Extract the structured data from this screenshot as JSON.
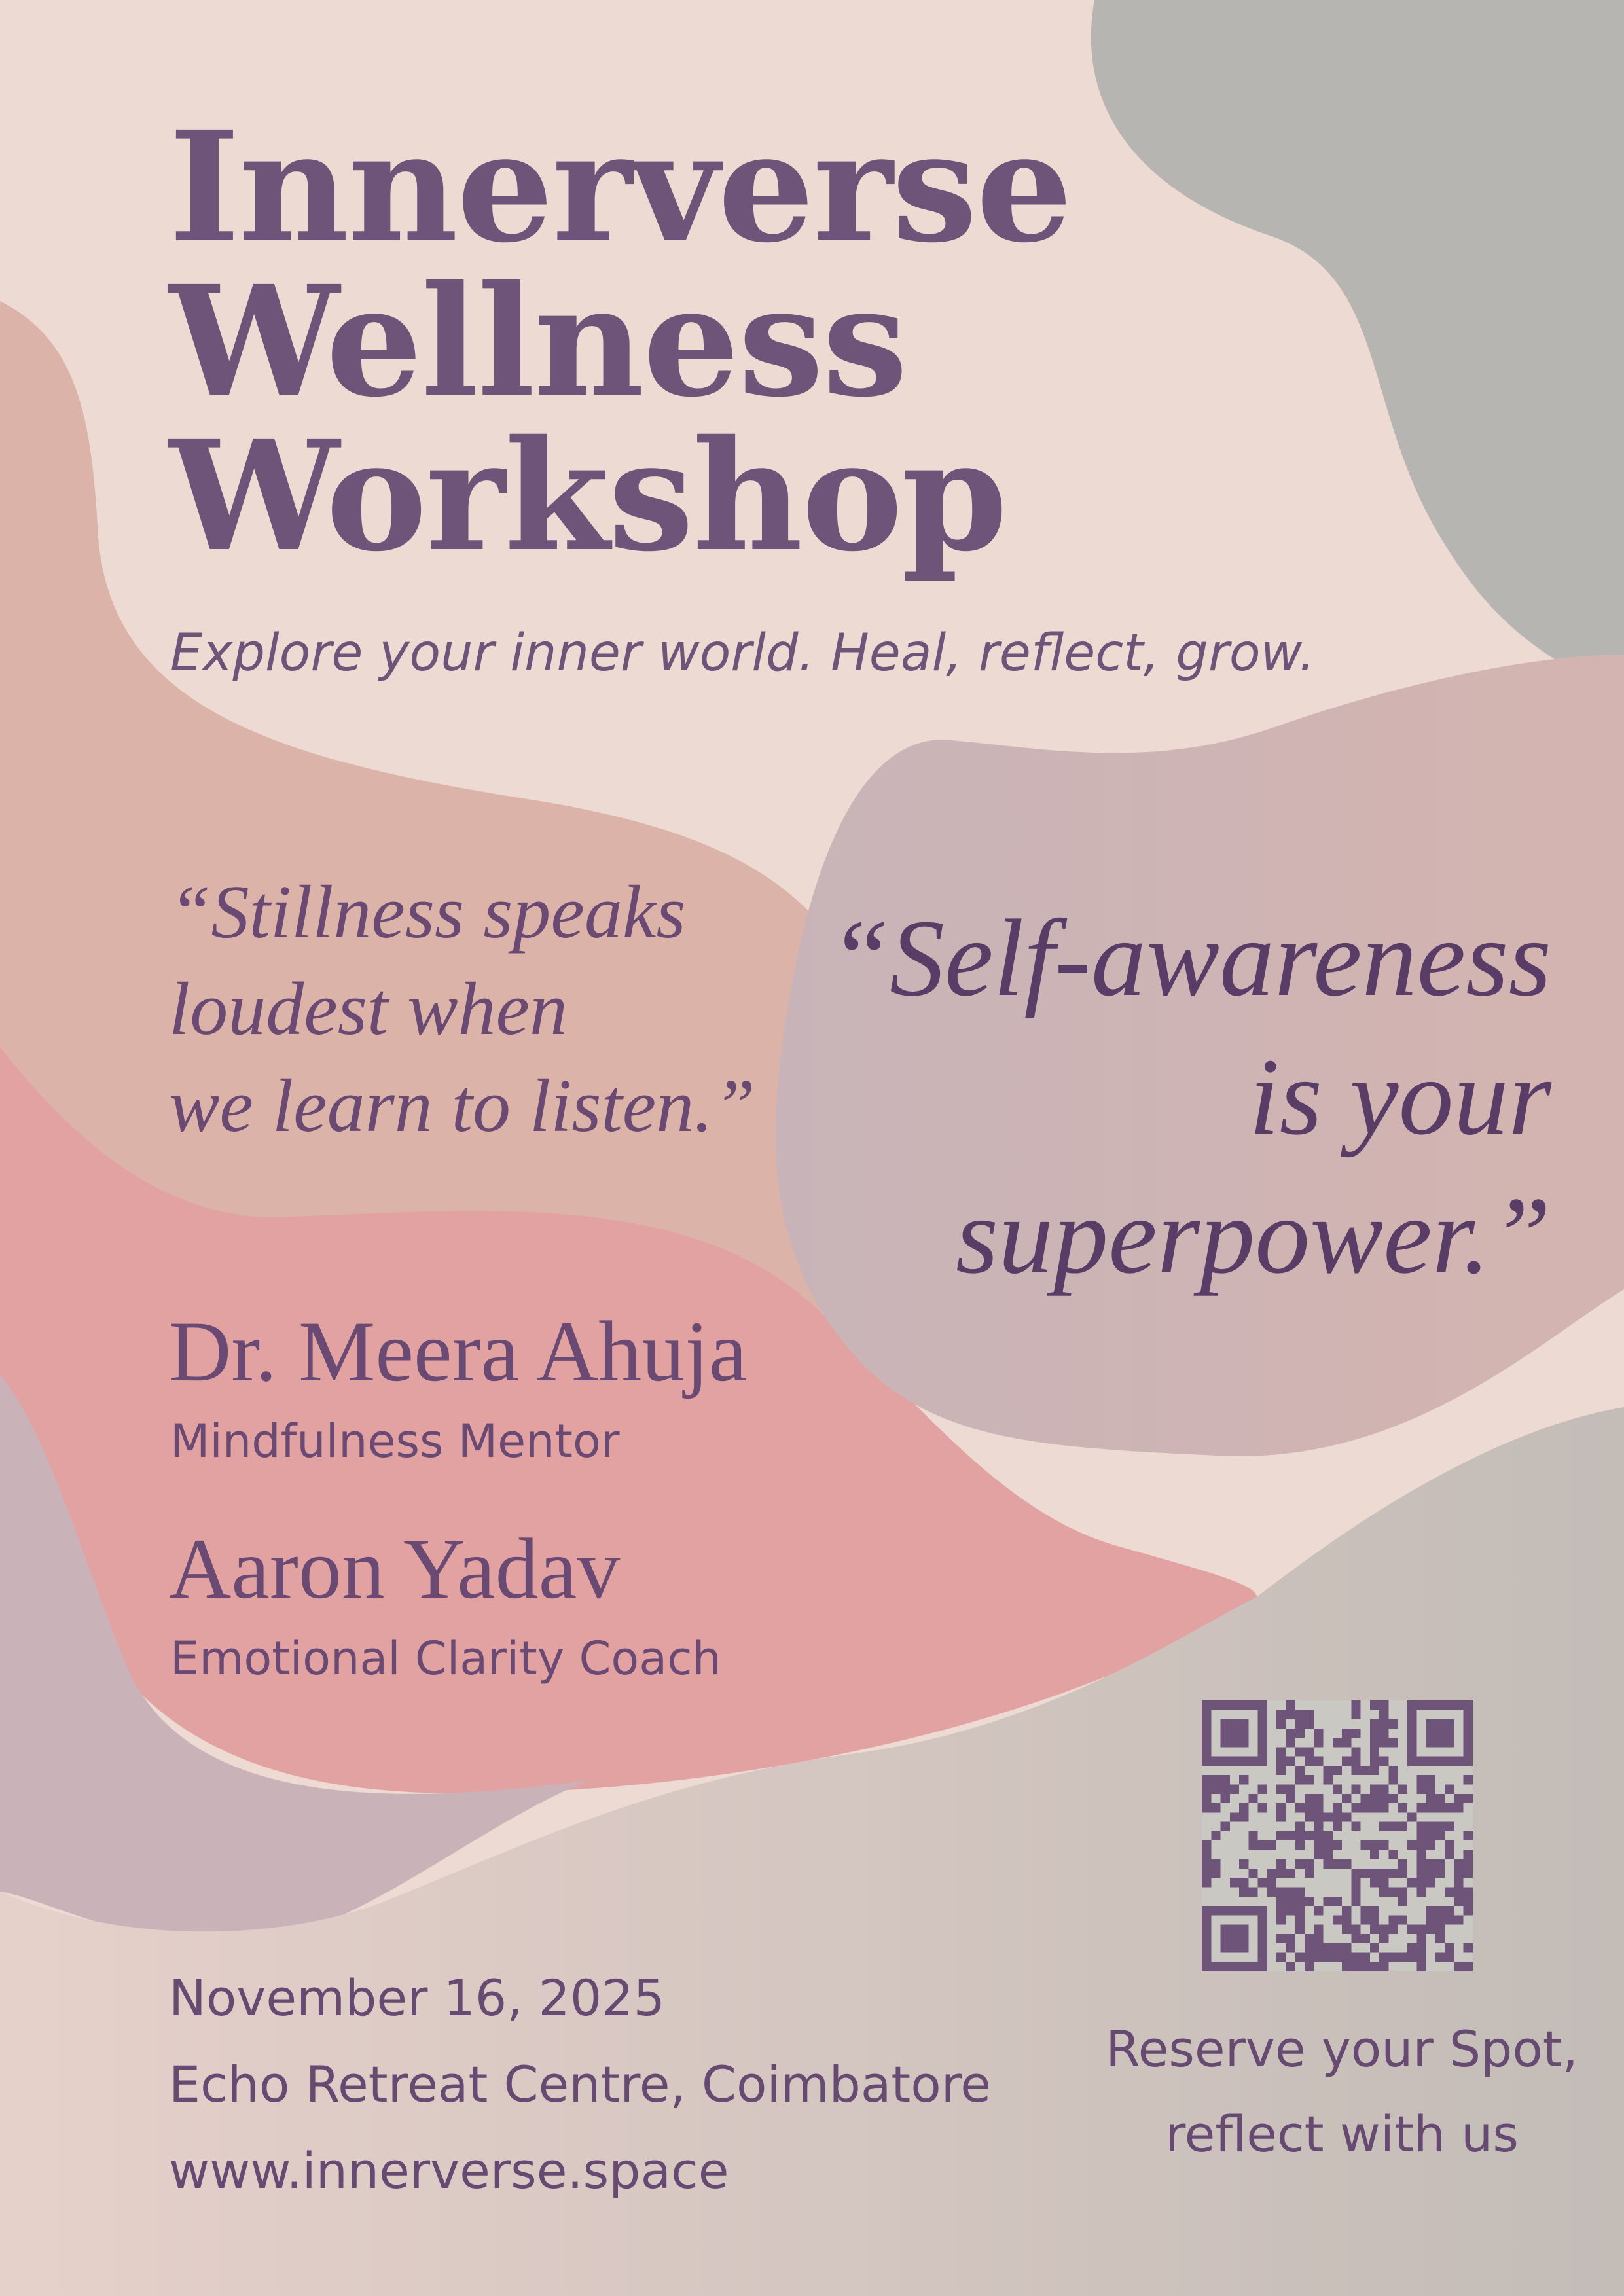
{
  "poster": {
    "title_lines": [
      "Innerverse",
      "Wellness",
      "Workshop"
    ],
    "tagline": "Explore your inner world. Heal, reflect, grow.",
    "quote_left_lines": [
      "“Stillness speaks",
      "loudest when",
      "we learn to listen.”"
    ],
    "quote_right_lines": [
      "“Self-awareness",
      "is your",
      "superpower.”"
    ],
    "speakers": [
      {
        "name": "Dr. Meera Ahuja",
        "role": "Mindfulness Mentor"
      },
      {
        "name": "Aaron Yadav",
        "role": "Emotional Clarity Coach"
      }
    ],
    "event": {
      "date": "November 16, 2025",
      "venue": "Echo Retreat Centre, Coimbatore",
      "website": "www.innerverse.space"
    },
    "cta_lines": [
      "Reserve your Spot,",
      "reflect with us"
    ],
    "qr_icon": "qr-code-icon"
  },
  "colors": {
    "background": "#eddad3",
    "grey_blob": "#b7b5b1",
    "mauve_blob": "#c9b3b8",
    "terracotta_blob": "#dcb3a8",
    "pink_blob": "#e3a2a2",
    "text_purple": "#6a4a72",
    "quote_dark_purple": "#5a3d66"
  }
}
